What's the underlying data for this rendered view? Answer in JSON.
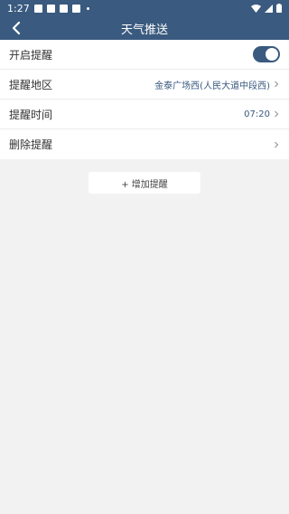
{
  "status": {
    "time": "1:27"
  },
  "nav": {
    "title": "天气推送"
  },
  "rows": [
    {
      "label": "开启提醒",
      "value": ""
    },
    {
      "label": "提醒地区",
      "value": "金泰广场西(人民大道中段西)"
    },
    {
      "label": "提醒时间",
      "value": "07:20"
    },
    {
      "label": "删除提醒",
      "value": ""
    }
  ],
  "toggle": {
    "enabled": true
  },
  "add_button": {
    "label": "+ 增加提醒"
  },
  "colors": {
    "primary": "#3a5a7f",
    "background": "#f2f2f2"
  }
}
